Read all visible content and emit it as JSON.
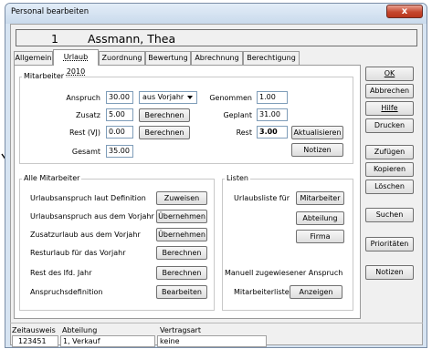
{
  "window": {
    "title": "Personal bearbeiten",
    "close_label": "x",
    "header_number": "1",
    "header_name": "Assmann, Thea"
  },
  "tabs": [
    {
      "label": "Allgemein"
    },
    {
      "label": "Urlaub 2010"
    },
    {
      "label": "Zuordnung"
    },
    {
      "label": "Bewertung"
    },
    {
      "label": "Abrechnung"
    },
    {
      "label": "Berechtigung"
    }
  ],
  "mitarbeiter": {
    "title": "Mitarbeiter",
    "anspruch_label": "Anspruch",
    "anspruch_value": "30.00",
    "anspruch_combo": "aus Vorjahr",
    "zusatz_label": "Zusatz",
    "zusatz_value": "5.00",
    "zusatz_button": "Berechnen",
    "rest_vj_label": "Rest (VJ)",
    "rest_vj_value": "0.00",
    "rest_vj_button": "Berechnen",
    "gesamt_label": "Gesamt",
    "gesamt_value": "35.00",
    "genommen_label": "Genommen",
    "genommen_value": "1.00",
    "geplant_label": "Geplant",
    "geplant_value": "31.00",
    "rest_label": "Rest",
    "rest_value": "3.00",
    "aktualisieren_button": "Aktualisieren",
    "notizen_button": "Notizen"
  },
  "alle_mitarbeiter": {
    "title": "Alle Mitarbeiter",
    "rows": [
      {
        "label": "Urlaubsanspruch laut Definition",
        "button": "Zuweisen"
      },
      {
        "label": "Urlaubsanspruch aus dem Vorjahr",
        "button": "Übernehmen"
      },
      {
        "label": "Zusatzurlaub aus dem Vorjahr",
        "button": "Übernehmen"
      },
      {
        "label": "Resturlaub für das Vorjahr",
        "button": "Berechnen"
      },
      {
        "label": "Rest des lfd. Jahr",
        "button": "Berechnen"
      },
      {
        "label": "Anspruchsdefinition",
        "button": "Bearbeiten"
      }
    ]
  },
  "listen": {
    "title": "Listen",
    "urlaubsliste_label": "Urlaubsliste für",
    "mitarbeiter_button": "Mitarbeiter",
    "abteilung_button": "Abteilung",
    "firma_button": "Firma",
    "manuell_label": "Manuell zugewiesener Anspruch",
    "mitarbeiterliste_label": "Mitarbeiterliste",
    "anzeigen_button": "Anzeigen"
  },
  "side_buttons": [
    {
      "label": "OK"
    },
    {
      "label": "Abbrechen"
    },
    {
      "label": "Hilfe"
    },
    {
      "label": "Drucken"
    },
    {
      "label": "Zufügen"
    },
    {
      "label": "Kopieren"
    },
    {
      "label": "Löschen"
    },
    {
      "label": "Suchen"
    },
    {
      "label": "Prioritäten"
    },
    {
      "label": "Notizen"
    }
  ],
  "status": {
    "zeitausweis_label": "Zeitausweis",
    "zeitausweis_value": "123451",
    "abteilung_label": "Abteilung",
    "abteilung_value": "1, Verkauf",
    "vertragsart_label": "Vertragsart",
    "vertragsart_value": "keine"
  },
  "colors": {
    "title_bar": "#c9daec",
    "close_button": "#c6472e",
    "panel_bg": "#f0f0f0"
  }
}
